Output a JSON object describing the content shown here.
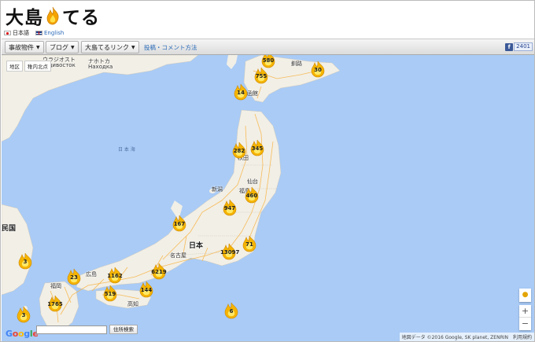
{
  "site": {
    "logo_left": "大島",
    "logo_right": "てる"
  },
  "languages": [
    {
      "label": "日本語"
    },
    {
      "label": "English"
    }
  ],
  "toolbar": {
    "menu1": "事故物件",
    "menu2": "ブログ",
    "menu3": "大島てるリンク",
    "link": "投稿・コメント方法",
    "fb_icon": "f",
    "fb_count": "2401"
  },
  "map": {
    "area_buttons": [
      "地区",
      "稚内北点"
    ],
    "labels": {
      "japan": "日本",
      "nagoya": "名古屋",
      "niigata": "新潟",
      "sendai": "仙台",
      "ussuriysk": "ウラジオスト",
      "vladivostok": "Владивосток",
      "nakhodka": "ナホトカ",
      "nakhodka_ru": "Находка",
      "sea": "日 本 海",
      "korea": "民国",
      "kushiro": "釧路",
      "hakodate": "函館",
      "fukushima": "福島",
      "akita": "秋田",
      "yamagata": "山形",
      "hiroshima": "広島",
      "fukuoka": "福岡",
      "kochi": "高知"
    },
    "clusters": [
      {
        "name": "sapporo",
        "count": "580"
      },
      {
        "name": "sapporo2",
        "count": "755"
      },
      {
        "name": "kushiro",
        "count": "30"
      },
      {
        "name": "hakodate",
        "count": "14"
      },
      {
        "name": "aomori",
        "count": "282"
      },
      {
        "name": "iwate",
        "count": "345"
      },
      {
        "name": "sendai",
        "count": "460"
      },
      {
        "name": "niigata",
        "count": "947"
      },
      {
        "name": "toyama",
        "count": "167"
      },
      {
        "name": "tokyo",
        "count": "13097"
      },
      {
        "name": "chiba",
        "count": "71"
      },
      {
        "name": "osaka",
        "count": "6219"
      },
      {
        "name": "okayama",
        "count": "1162"
      },
      {
        "name": "shikoku",
        "count": "519"
      },
      {
        "name": "kochi",
        "count": "144"
      },
      {
        "name": "fukuoka",
        "count": "1765"
      },
      {
        "name": "kagoshima",
        "count": "3"
      },
      {
        "name": "hachijo",
        "count": "6"
      },
      {
        "name": "tsushima",
        "count": "23"
      },
      {
        "name": "korea",
        "count": "3"
      }
    ],
    "address_button": "住所検索",
    "attribution": "地図データ ©2016 Google, SK planet, ZENRIN　利用規約",
    "zoom_in": "+",
    "zoom_out": "−",
    "google_letters": [
      "G",
      "o",
      "o",
      "g",
      "l",
      "e"
    ]
  },
  "colors": {
    "water": "#a9cbf6",
    "land": "#f2efe6",
    "road": "#f7b64a",
    "fire": "#f5b400"
  }
}
